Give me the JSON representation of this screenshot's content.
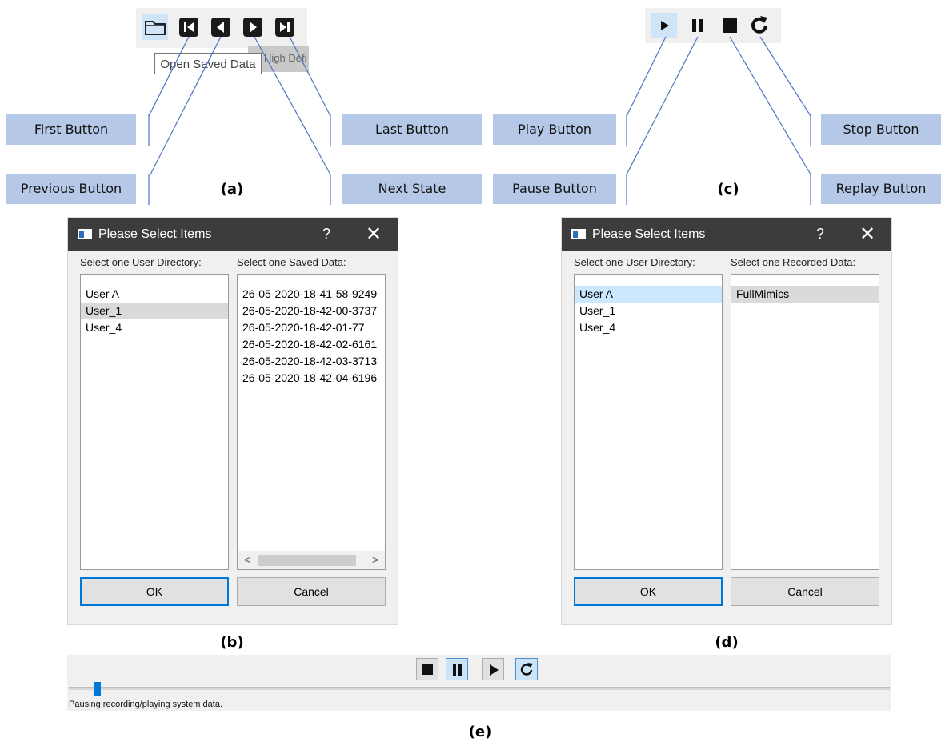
{
  "panel_a": {
    "caption": "(a)",
    "tooltip": "Open Saved Data",
    "behind_tooltip": "High Defi",
    "labels": {
      "first": "First Button",
      "previous": "Previous Button",
      "last": "Last Button",
      "next": "Next State"
    }
  },
  "panel_c": {
    "caption": "(c)",
    "labels": {
      "play": "Play Button",
      "pause": "Pause Button",
      "stop": "Stop Button",
      "replay": "Replay Button"
    }
  },
  "panel_b": {
    "caption": "(b)",
    "title": "Please Select Items",
    "help": "?",
    "close": "✕",
    "left_label": "Select one User Directory:",
    "right_label": "Select one Saved Data:",
    "users": [
      "User A",
      "User_1",
      "User_4"
    ],
    "selected_user": "User_1",
    "saved_data": [
      "26-05-2020-18-41-58-9249",
      "26-05-2020-18-42-00-3737",
      "26-05-2020-18-42-01-77",
      "26-05-2020-18-42-02-6161",
      "26-05-2020-18-42-03-3713",
      "26-05-2020-18-42-04-6196"
    ],
    "scroll_left": "<",
    "scroll_right": ">",
    "ok": "OK",
    "cancel": "Cancel"
  },
  "panel_d": {
    "caption": "(d)",
    "title": "Please Select Items",
    "help": "?",
    "close": "✕",
    "left_label": "Select one User Directory:",
    "right_label": "Select one Recorded Data:",
    "users": [
      "User A",
      "User_1",
      "User_4"
    ],
    "selected_user": "User A",
    "recorded_data": [
      "FullMimics"
    ],
    "ok": "OK",
    "cancel": "Cancel"
  },
  "panel_e": {
    "caption": "(e)",
    "status": "Pausing recording/playing system data.",
    "controls": [
      "stop",
      "pause",
      "play",
      "replay"
    ],
    "active": [
      "pause",
      "replay"
    ],
    "progress_fraction": 0.03
  },
  "colors": {
    "callout": "#b6c8e7",
    "accent": "#0078d7",
    "title_bar": "#3c3c3c",
    "selection": "#cce8ff"
  }
}
